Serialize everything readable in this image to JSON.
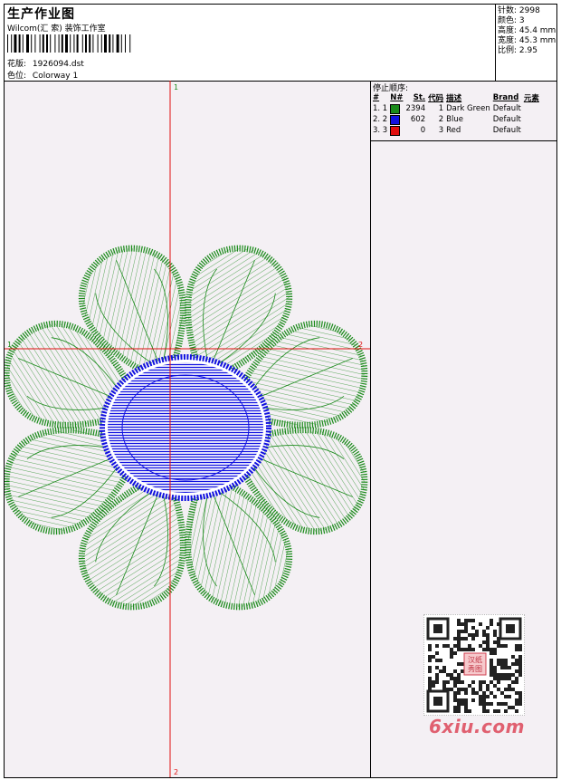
{
  "header": {
    "title": "生产作业图",
    "studio": "Wilcom(汇 索) 装饰工作室",
    "design_label": "花版:",
    "design_value": "1926094.dst",
    "colorway_label": "色位:",
    "colorway_value": "Colorway 1"
  },
  "stats": {
    "stitches": "针数: 2998",
    "colors": "颜色: 3",
    "height": "高度: 45.4 mm",
    "width": "宽度: 45.3 mm",
    "ratio": "比例: 2.95"
  },
  "stop_sequence": {
    "heading": "停止顺序:",
    "columns": [
      "#",
      "N#",
      "St.",
      "代码",
      "描述",
      "Brand",
      "元素"
    ],
    "rows": [
      {
        "idx": "1. 1",
        "color": "#1a8a1a",
        "st": "2394",
        "code": "1",
        "desc": "Dark Green",
        "brand": "Default"
      },
      {
        "idx": "2. 2",
        "color": "#1010e0",
        "st": "602",
        "code": "2",
        "desc": "Blue",
        "brand": "Default"
      },
      {
        "idx": "3. 3",
        "color": "#e01010",
        "st": "0",
        "code": "3",
        "desc": "Red",
        "brand": "Default"
      }
    ]
  },
  "markers": {
    "top": "1",
    "bottom": "2",
    "left": "1",
    "right": "2"
  },
  "watermark": {
    "site": "6xiu.com",
    "stamp": "汉纸秀图"
  },
  "colors": {
    "petal": "#1a8a1a",
    "center": "#1010e0",
    "axis": "#e01010"
  }
}
